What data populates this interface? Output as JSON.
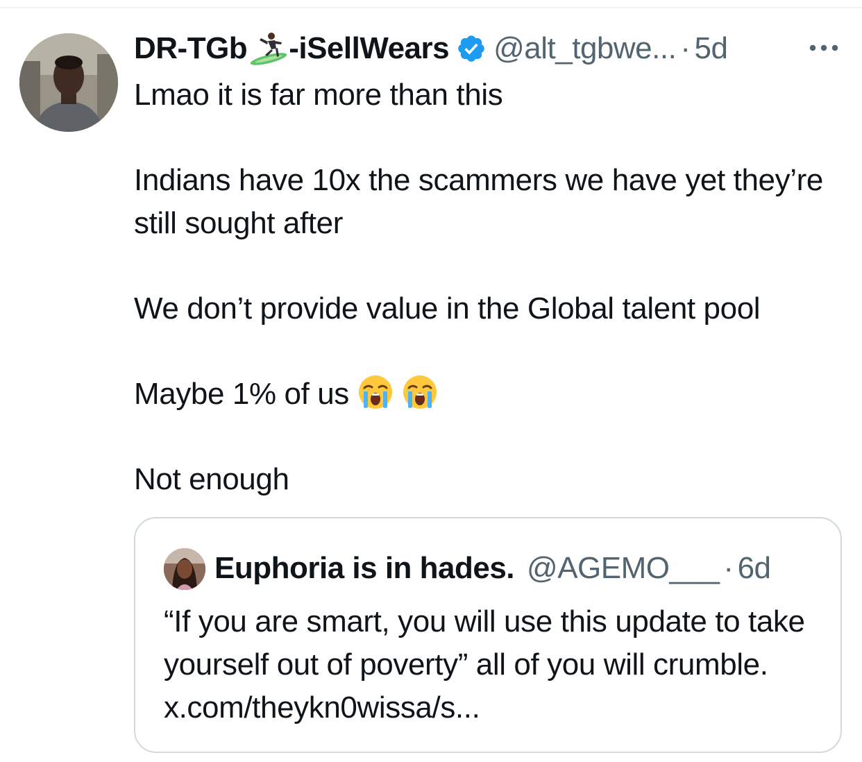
{
  "tweet": {
    "author_name": "DR-TGb",
    "author_name_suffix": "-iSellWears",
    "handle": "@alt_tgbwe...",
    "separator": "·",
    "time": "5d",
    "icons": {
      "emoji_in_name": "surfer-emoji-icon",
      "verified": "verified-badge-icon",
      "more": "more-options-icon",
      "reaction": "loudly-crying-face-emoji-icon"
    },
    "body": {
      "line_1": "Lmao it is far more than this",
      "line_2": "Indians have 10x the scammers we have yet they’re still sought after",
      "line_3": "We don’t provide value in the Global talent pool",
      "line_4": "Maybe 1% of us",
      "line_5": "Not enough"
    }
  },
  "quoted_tweet": {
    "author_name": "Euphoria is in hades.",
    "handle": "@AGEMO___",
    "separator": "·",
    "time": "6d",
    "text": "“If you are smart, you will use this update to take yourself out of poverty” all of you will crumble. x.com/theykn0wissa/s..."
  },
  "colors": {
    "text_primary": "#0f1419",
    "text_secondary": "#536471",
    "border": "#cfd9de",
    "verified_blue": "#1d9bf0"
  }
}
